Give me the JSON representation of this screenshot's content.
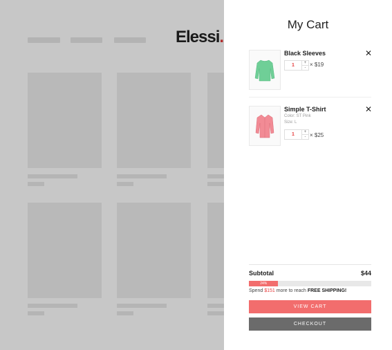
{
  "store": {
    "logo_text": "Elessi",
    "logo_dot": "."
  },
  "cart": {
    "title": "My Cart",
    "items": [
      {
        "name": "Black Sleeves",
        "qty": "1",
        "qty_plus": "+",
        "qty_minus": "-",
        "price": "× $19",
        "remove": "✕",
        "color": "",
        "size": ""
      },
      {
        "name": "Simple T-Shirt",
        "qty": "1",
        "qty_plus": "+",
        "qty_minus": "-",
        "price": "× $25",
        "remove": "✕",
        "color": "Color: ST Pink",
        "size": "Size: L"
      }
    ],
    "subtotal_label": "Subtotal",
    "subtotal_value": "$44",
    "progress_percent": 24,
    "progress_label": "24%",
    "shipping_msg_prefix": "Spend ",
    "shipping_amount": "$151",
    "shipping_msg_middle": " more to reach ",
    "shipping_msg_bold": "FREE SHIPPING!",
    "view_cart_label": "VIEW CART",
    "checkout_label": "CHECKOUT"
  },
  "colors": {
    "accent": "#f26d6d",
    "checkout": "#6b6b6b",
    "item1_shirt": "#6fcf97",
    "item2_shirt": "#f28b95"
  }
}
